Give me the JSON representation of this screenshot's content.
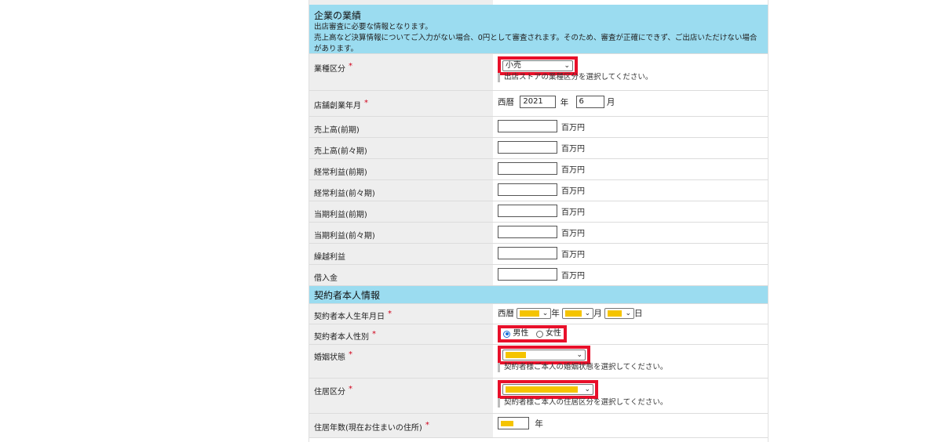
{
  "company_section": {
    "title": "企業の業績",
    "desc1": "出店審査に必要な情報となります。",
    "desc2": "売上高など決算情報についてご入力がない場合、0円として審査されます。そのため、審査が正確にできず、ご出店いただけない場合",
    "desc3": "があります。"
  },
  "required_mark": "*",
  "business_type": {
    "label": "業種区分",
    "value": "小売",
    "note": "出店ストアの業種区分を選択してください。"
  },
  "founding": {
    "label": "店舗創業年月",
    "era": "西暦",
    "year": "2021",
    "year_unit": "年",
    "month": "6",
    "month_unit": "月"
  },
  "financials": {
    "unit": "百万円",
    "rows": [
      {
        "label": "売上高(前期)"
      },
      {
        "label": "売上高(前々期)"
      },
      {
        "label": "経常利益(前期)"
      },
      {
        "label": "経常利益(前々期)"
      },
      {
        "label": "当期利益(前期)"
      },
      {
        "label": "当期利益(前々期)"
      },
      {
        "label": "繰越利益"
      },
      {
        "label": "借入金"
      }
    ]
  },
  "personal_section": {
    "title": "契約者本人情報"
  },
  "birthdate": {
    "label": "契約者本人生年月日",
    "era": "西暦",
    "year_unit": "年",
    "month_unit": "月",
    "day_unit": "日"
  },
  "gender": {
    "label": "契約者本人性別",
    "male": "男性",
    "female": "女性",
    "selected": "male"
  },
  "marital": {
    "label": "婚姻状態",
    "note": "契約者様ご本人の婚姻状態を選択してください。"
  },
  "residence": {
    "label": "住居区分",
    "note": "契約者様ご本人の住居区分を選択してください。"
  },
  "residence_years": {
    "label": "住居年数(現在お住まいの住所)",
    "unit": "年"
  },
  "colors": {
    "section_bg": "#9bdcf0",
    "label_bg": "#eeeeee",
    "highlight": "#e8102a",
    "redaction": "#f5c400",
    "required": "#d0021b"
  }
}
